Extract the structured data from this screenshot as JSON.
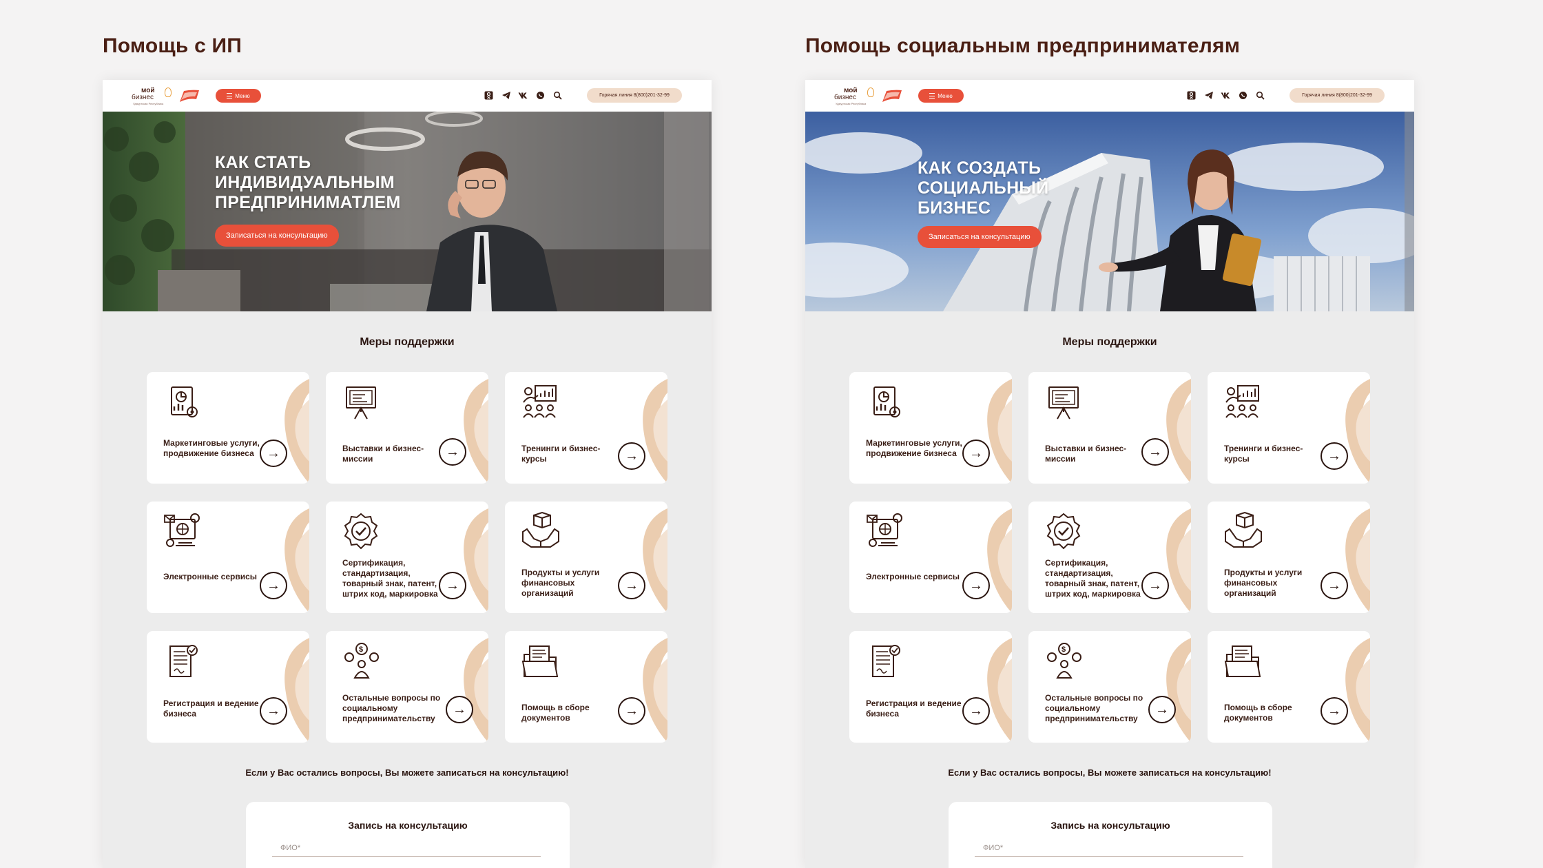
{
  "panels": [
    {
      "title": "Помощь с ИП",
      "header": {
        "logo_top": "мой",
        "logo_main": "бизнес",
        "logo_sub": "Удмуртская Республика",
        "menu_label": "Меню",
        "hotline": "Горячая линия 8(800)201-32-99",
        "icons": [
          "odnoklassniki-icon",
          "telegram-icon",
          "vk-icon",
          "whatsapp-icon",
          "search-icon"
        ]
      },
      "hero": {
        "title_lines": [
          "КАК СТАТЬ",
          "ИНДИВИДУАЛЬНЫМ",
          "ПРЕДПРИНИМАТЛЕМ"
        ],
        "button": "Записаться на консультацию"
      },
      "support": {
        "title": "Меры поддержки",
        "cards": [
          "Маркетинговые услуги, продвижение бизнеса",
          "Выставки и бизнес-миссии",
          "Тренинги и бизнес-курсы",
          "Электронные сервисы",
          "Сертификация, стандартизация, товарный знак, патент, штрих код, маркировка",
          "Продукты и услуги финансовых организаций",
          "Регистрация и ведение бизнеса",
          "Остальные вопросы по социальному предпринимательству",
          "Помощь в сборе документов"
        ]
      },
      "bottom_text": "Если у Вас остались вопросы, Вы можете записаться на консультацию!",
      "form": {
        "title": "Запись на консультацию",
        "fio_placeholder": "ФИО*"
      }
    },
    {
      "title": "Помощь социальным предпринимателям",
      "header": {
        "logo_top": "мой",
        "logo_main": "бизнес",
        "logo_sub": "Удмуртская Республика",
        "menu_label": "Меню",
        "hotline": "Горячая линия 8(800)201-32-99",
        "icons": [
          "odnoklassniki-icon",
          "telegram-icon",
          "vk-icon",
          "whatsapp-icon",
          "search-icon"
        ]
      },
      "hero": {
        "title_lines": [
          "КАК СОЗДАТЬ",
          "СОЦИАЛЬНЫЙ",
          "БИЗНЕС"
        ],
        "button": "Записаться на консультацию"
      },
      "support": {
        "title": "Меры поддержки",
        "cards": [
          "Маркетинговые услуги, продвижение бизнеса",
          "Выставки и бизнес-миссии",
          "Тренинги и бизнес-курсы",
          "Электронные сервисы",
          "Сертификация, стандартизация, товарный знак, патент, штрих код, маркировка",
          "Продукты и услуги финансовых организаций",
          "Регистрация и ведение бизнеса",
          "Остальные вопросы по социальному предпринимательству",
          "Помощь в сборе документов"
        ]
      },
      "bottom_text": "Если у Вас остались вопросы, Вы можете записаться на консультацию!",
      "form": {
        "title": "Запись на консультацию",
        "fio_placeholder": "ФИО*"
      }
    }
  ],
  "colors": {
    "accent": "#e8503a",
    "brown": "#4a1f14",
    "peach": "#f1dccb",
    "card_deco": "#e9c9a8",
    "page_bg": "#ececec"
  }
}
